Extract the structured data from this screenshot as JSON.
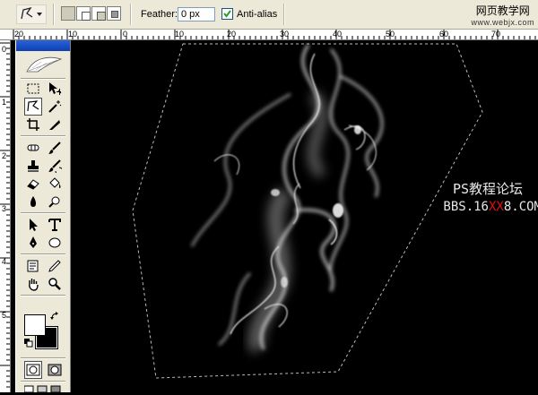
{
  "options_bar": {
    "feather_label": "Feather:",
    "feather_value": "0 px",
    "antialias_label": "Anti-alias",
    "antialias_checked": true
  },
  "watermark": {
    "title": "网页教学网",
    "url": "www.webjx.com"
  },
  "ruler_top": {
    "labels": [
      "20",
      "10",
      "0",
      "10",
      "20",
      "30",
      "40",
      "50",
      "60",
      "70"
    ]
  },
  "ruler_left": {
    "labels": [
      "0",
      "1",
      "2",
      "3",
      "4",
      "5"
    ]
  },
  "canvas_text": {
    "line1": "PS教程论坛",
    "line2_a": "BBS.16",
    "line2_b": "XX",
    "line2_c": "8.COM"
  },
  "colors": {
    "ui_face": "#ECE9D8",
    "palette_title": "#0a3fb3",
    "canvas_bg": "#000000",
    "red_text": "#e30e0e"
  },
  "icons": [
    "polygonal-lasso-icon",
    "marquee-icon",
    "move-icon",
    "magic-wand-icon",
    "crop-icon",
    "slice-icon",
    "healing-brush-icon",
    "brush-icon",
    "clone-stamp-icon",
    "history-brush-icon",
    "eraser-icon",
    "paint-bucket-icon",
    "blur-icon",
    "dodge-icon",
    "path-selection-icon",
    "type-icon",
    "pen-icon",
    "shape-icon",
    "notes-icon",
    "eyedropper-icon",
    "hand-icon",
    "zoom-icon"
  ]
}
